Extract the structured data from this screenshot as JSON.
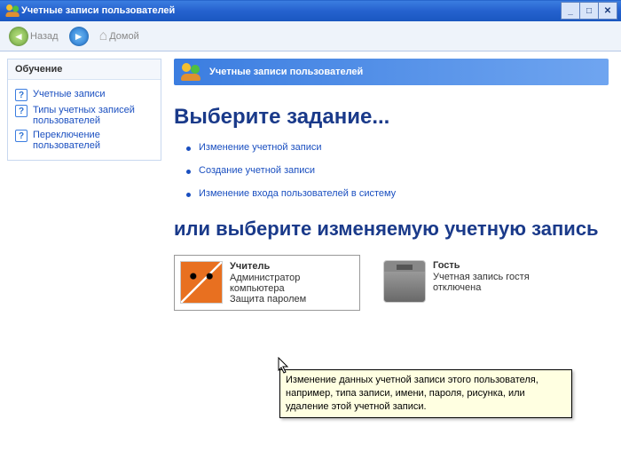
{
  "window": {
    "title": "Учетные записи пользователей"
  },
  "toolbar": {
    "back": "Назад",
    "home": "Домой"
  },
  "sidebar": {
    "header": "Обучение",
    "items": [
      {
        "label": "Учетные записи"
      },
      {
        "label": "Типы учетных записей пользователей"
      },
      {
        "label": "Переключение пользователей"
      }
    ]
  },
  "main": {
    "section_title": "Учетные записи пользователей",
    "task_heading": "Выберите задание...",
    "tasks": [
      "Изменение учетной записи",
      "Создание учетной записи",
      "Изменение входа пользователей в систему"
    ],
    "sub_heading": "или выберите изменяемую учетную запись",
    "accounts": [
      {
        "name": "Учитель",
        "line1": "Администратор компьютера",
        "line2": "Защита паролем"
      },
      {
        "name": "Гость",
        "line1": "Учетная запись гостя отключена",
        "line2": ""
      }
    ]
  },
  "tooltip": "Изменение данных учетной записи этого пользователя, например, типа записи, имени, пароля, рисунка, или удаление этой учетной записи."
}
